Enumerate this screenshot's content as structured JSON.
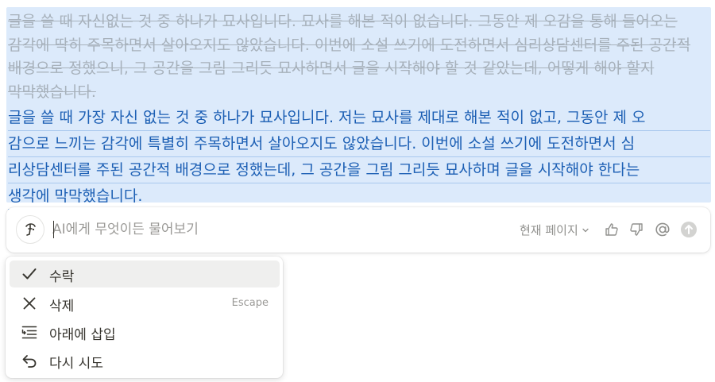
{
  "document": {
    "original_text": "글을 쓸 때 자신없는 것 중 하나가 묘사입니다. 묘사를 해본 적이 없습니다. 그동안 제 오감을 통해 들어오는 감각에 딱히 주목하면서 살아오지도 않았습니다. 이번에 소설 쓰기에 도전하면서 심리상담센터를 주된 공간적 배경으로 정했으니, 그 공간을 그림 그리듯 묘사하면서 글을 시작해야 할 것 같았는데, 어떻게 해야 할지 막막했습니다.",
    "suggested_lines": [
      "글을 쓸 때 가장 자신 없는 것 중 하나가 묘사입니다. 저는 묘사를 제대로 해본 적이 없고, 그동안 제 오",
      "감으로 느끼는 감각에 특별히 주목하면서 살아오지도 않았습니다. 이번에 소설 쓰기에 도전하면서 심",
      "리상담센터를 주된 공간적 배경으로 정했는데, 그 공간을 그림 그리듯 묘사하며 글을 시작해야 한다는",
      "생각에 막막했습니다."
    ]
  },
  "ai_bar": {
    "placeholder": "AI에게 무엇이든 물어보기",
    "scope_label": "현재 페이지"
  },
  "menu": {
    "items": [
      {
        "label": "수락",
        "shortcut": ""
      },
      {
        "label": "삭제",
        "shortcut": "Escape"
      },
      {
        "label": "아래에 삽입",
        "shortcut": ""
      },
      {
        "label": "다시 시도",
        "shortcut": ""
      }
    ]
  },
  "colors": {
    "selection_bg": "#dceafb",
    "suggested_text": "#1c5fb4",
    "struck_text": "#a7b1bb"
  }
}
